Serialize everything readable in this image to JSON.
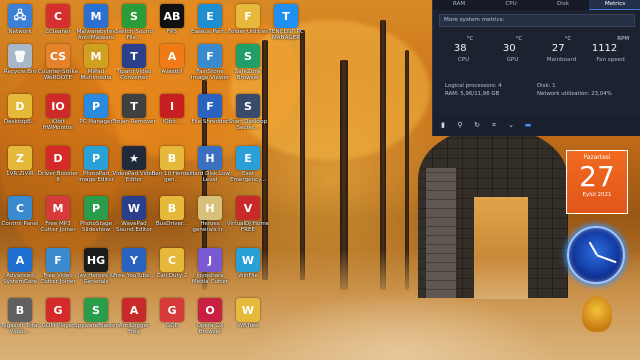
{
  "desktop_icons": [
    {
      "label": "Network",
      "color": "#3b7fd6",
      "glyph": "🖧"
    },
    {
      "label": "CCleaner",
      "color": "#d62f2f",
      "glyph": "C"
    },
    {
      "label": "Malwarebytes Anti-Malware",
      "color": "#2a6fd1",
      "glyph": "M"
    },
    {
      "label": "Switch Sound File...",
      "color": "#2b9c3a",
      "glyph": "S"
    },
    {
      "label": "FPS",
      "color": "#111111",
      "glyph": "AB"
    },
    {
      "label": "Easeus Part...",
      "color": "#1d8fd1",
      "glyph": "E"
    },
    {
      "label": "Folder Utilities",
      "color": "#e6b93a",
      "glyph": "F"
    },
    {
      "label": "TENCENT PC MANAGER",
      "color": "#1f8ff0",
      "glyph": "T"
    },
    {
      "label": "Recycle Bin",
      "color": "#a8b8c8",
      "glyph": "🗑"
    },
    {
      "label": "Counter-Strike WeROOTE",
      "color": "#e6822b",
      "glyph": "CS"
    },
    {
      "label": "MiPad Multimedia",
      "color": "#d0a020",
      "glyph": "M"
    },
    {
      "label": "Tipard Video Converter",
      "color": "#2c3f8c",
      "glyph": "T"
    },
    {
      "label": "AvastUI",
      "color": "#f07b16",
      "glyph": "A"
    },
    {
      "label": "FastStone Image Viewer",
      "color": "#3a8ad0",
      "glyph": "F"
    },
    {
      "label": "SafeZone Browser",
      "color": "#20a068",
      "glyph": "S"
    },
    {
      "label": "DesktopB...",
      "color": "#e6b93a",
      "glyph": "D"
    },
    {
      "label": "IObit HWMonitor",
      "color": "#cf2a2a",
      "glyph": "IO"
    },
    {
      "label": "PC Manager",
      "color": "#2a8ae0",
      "glyph": "P"
    },
    {
      "label": "Trojan Remover",
      "color": "#404040",
      "glyph": "T"
    },
    {
      "label": "IObit...",
      "color": "#c82020",
      "glyph": "I"
    },
    {
      "label": "File Shredder",
      "color": "#2a62c0",
      "glyph": "F"
    },
    {
      "label": "Start Desktop Secret...",
      "color": "#3a4a6a",
      "glyph": "S"
    },
    {
      "label": "1VR ZIVIR",
      "color": "#e6b93a",
      "glyph": "Z"
    },
    {
      "label": "Driver Booster 8",
      "color": "#d42a2a",
      "glyph": "D"
    },
    {
      "label": "PhotoPad Image Editor",
      "color": "#2aa0d8",
      "glyph": "P"
    },
    {
      "label": "VideoPad Video Editor",
      "color": "#202a3a",
      "glyph": "★"
    },
    {
      "label": "Ben 10 Heroes gen...",
      "color": "#e6b93a",
      "glyph": "B"
    },
    {
      "label": "Hard Disk Low Level",
      "color": "#3a70c0",
      "glyph": "H"
    },
    {
      "label": "Eset Emergency...",
      "color": "#2aa0d8",
      "glyph": "E"
    },
    {
      "label": "Control Panel",
      "color": "#3a8ad0",
      "glyph": "C"
    },
    {
      "label": "Free MP3 Cutter Joiner",
      "color": "#d63a3a",
      "glyph": "M"
    },
    {
      "label": "PhotoStage Slideshow",
      "color": "#2a9c4a",
      "glyph": "P"
    },
    {
      "label": "WavePad Sound Editor",
      "color": "#2a3f8c",
      "glyph": "W"
    },
    {
      "label": "BusDriver...",
      "color": "#e6b93a",
      "glyph": "B"
    },
    {
      "label": "Heroes generals tr...",
      "color": "#d8c07a",
      "glyph": "H"
    },
    {
      "label": "VirtualDJ Home FREE",
      "color": "#c82a2a",
      "glyph": "V"
    },
    {
      "label": "Advanced SystemCare",
      "color": "#1f6fd0",
      "glyph": "A"
    },
    {
      "label": "Free Video Cutter Joiner",
      "color": "#3a8ad0",
      "glyph": "F"
    },
    {
      "label": "Jay Heroes & Generals",
      "color": "#1c1c1c",
      "glyph": "HG"
    },
    {
      "label": "Free YouTube...",
      "color": "#2a62c0",
      "glyph": "Y"
    },
    {
      "label": "Call Duty 2",
      "color": "#e6b93a",
      "glyph": "C"
    },
    {
      "label": "Joyoshare Media Cutter",
      "color": "#7a5ad0",
      "glyph": "J"
    },
    {
      "label": "WinFile",
      "color": "#2aa0d8",
      "glyph": "W"
    },
    {
      "label": "Bigasoft Total Video...",
      "color": "#606060",
      "glyph": "B"
    },
    {
      "label": "GOM Player",
      "color": "#d42a2a",
      "glyph": "G"
    },
    {
      "label": "SpywareBlaster",
      "color": "#2a9c4a",
      "glyph": "S"
    },
    {
      "label": "AntiLogger Free",
      "color": "#c82a2a",
      "glyph": "A"
    },
    {
      "label": "GOE",
      "color": "#d83a3a",
      "glyph": "G"
    },
    {
      "label": "Opera GX Browser",
      "color": "#c82040",
      "glyph": "O"
    },
    {
      "label": "WBTree",
      "color": "#e6b93a",
      "glyph": "W"
    }
  ],
  "performance_panel": {
    "tabs": [
      {
        "label": "RAM",
        "active": false
      },
      {
        "label": "CPU",
        "active": false
      },
      {
        "label": "Disk",
        "active": false
      },
      {
        "label": "Metrics",
        "active": true
      }
    ],
    "header": "More system metrics:",
    "metrics": [
      {
        "value": "38",
        "unit": "°C",
        "label": "CPU"
      },
      {
        "value": "30",
        "unit": "°C",
        "label": "GPU"
      },
      {
        "value": "27",
        "unit": "°C",
        "label": "Mainboard"
      },
      {
        "value": "1112",
        "unit": "RPM",
        "label": "Fan speed"
      }
    ],
    "details_left": [
      "Logical processors: 4",
      "RAM: 5,96/11,96 GB"
    ],
    "details_right": [
      "Disk: 1",
      "Network utilization: 23,04%"
    ]
  },
  "calendar": {
    "day_name": "Pazartesi",
    "day": "27",
    "month_year": "Eylül 2021"
  }
}
